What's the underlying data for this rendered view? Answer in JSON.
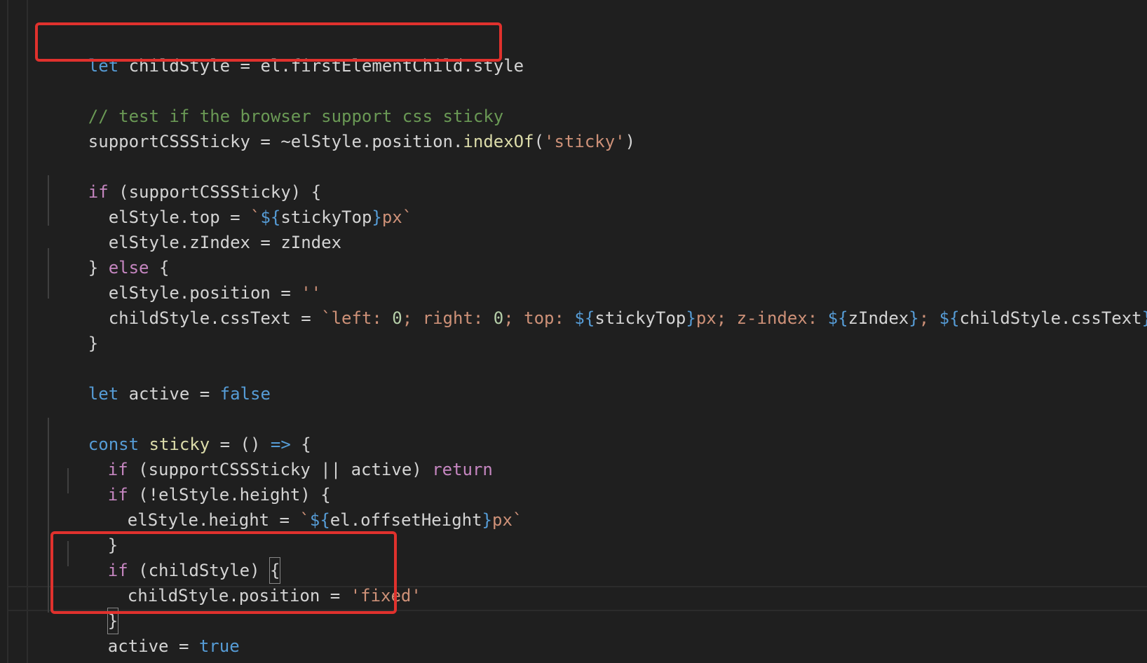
{
  "editor": {
    "theme": "dark",
    "accent_highlight": "#e0312d"
  },
  "code": {
    "line1": {
      "let": "let",
      "name": " childStyle = el.firstElementChild.style"
    },
    "line2": {
      "comment": "// test if the browser support css sticky"
    },
    "line3": {
      "a": "supportCSSSticky = ~elStyle.position.",
      "fn": "indexOf",
      "b": "(",
      "str": "'sticky'",
      "c": ")"
    },
    "line4": {
      "if": "if",
      "rest": " (supportCSSSticky) {"
    },
    "line5": {
      "a": "  elStyle.top = ",
      "tick": "`",
      "tpl_open": "${",
      "v": "stickyTop",
      "tpl_close": "}",
      "px": "px",
      "tick2": "`"
    },
    "line6": {
      "a": "  elStyle.zIndex = zIndex"
    },
    "line7": {
      "a": "} ",
      "else": "else",
      "b": " {"
    },
    "line8": {
      "a": "  elStyle.position = ",
      "str": "''"
    },
    "line9": {
      "a": "  childStyle.cssText = ",
      "s1": "`left: ",
      "n1": "0",
      "s2": "; right: ",
      "n2": "0",
      "s3": "; top: ",
      "t1o": "${",
      "v1": "stickyTop",
      "t1c": "}",
      "s4": "px; z-index: ",
      "t2o": "${",
      "v2": "zIndex",
      "t2c": "}",
      "s5": "; ",
      "t3o": "${",
      "v3": "childStyle.cssText",
      "t3c": "}",
      "s6": "`"
    },
    "line10": {
      "a": "}"
    },
    "line11": {
      "let": "let",
      "b": " active = ",
      "false": "false"
    },
    "line12": {
      "const": "const",
      "sp": " ",
      "fn": "sticky",
      "b": " = () ",
      "arrow": "=>",
      "c": " {"
    },
    "line13": {
      "if": "if",
      "b": " (supportCSSSticky || active) ",
      "ret": "return"
    },
    "line14": {
      "if": "if",
      "b": " (!elStyle.height) {"
    },
    "line15": {
      "a": "elStyle.height = ",
      "tick": "`",
      "to": "${",
      "v": "el.offsetHeight",
      "tc": "}",
      "px": "px",
      "tick2": "`"
    },
    "line16": {
      "a": "}"
    },
    "line17": {
      "if": "if",
      "b": " (childStyle) ",
      "brace": "{"
    },
    "line18": {
      "a": "childStyle.position = ",
      "str": "'fixed'"
    },
    "line19": {
      "brace": "}"
    },
    "line20": {
      "a": "active = ",
      "true": "true"
    },
    "line21": {
      "a": "}"
    }
  }
}
